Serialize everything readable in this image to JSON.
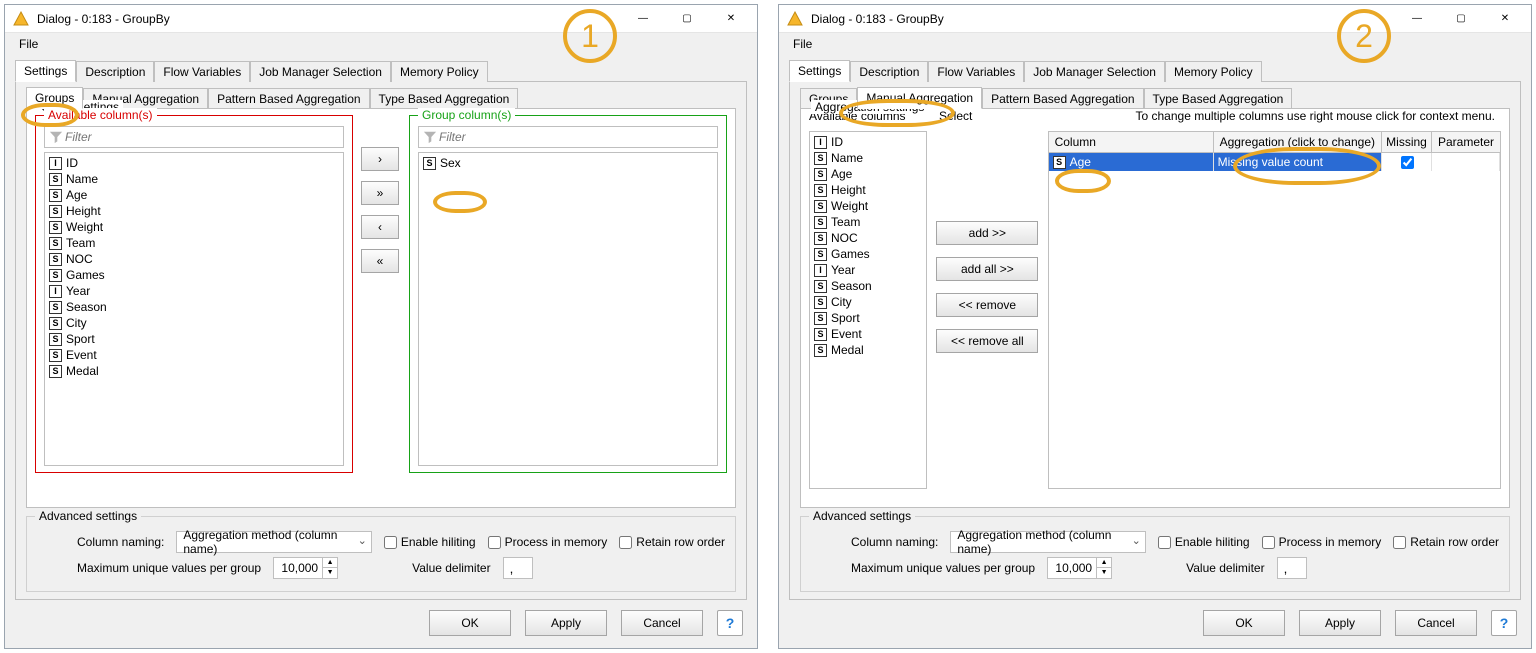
{
  "windowTitle": "Dialog - 0:183 - GroupBy",
  "menu": {
    "file": "File"
  },
  "tabs": {
    "outer": [
      "Settings",
      "Description",
      "Flow Variables",
      "Job Manager Selection",
      "Memory Policy"
    ],
    "inner": [
      "Groups",
      "Manual Aggregation",
      "Pattern Based Aggregation",
      "Type Based Aggregation"
    ]
  },
  "groupSettings": {
    "title": "Group settings",
    "availableTitle": "Available column(s)",
    "groupTitle": "Group column(s)",
    "filterPlaceholder": "Filter",
    "available": [
      {
        "type": "I",
        "name": "ID"
      },
      {
        "type": "S",
        "name": "Name"
      },
      {
        "type": "S",
        "name": "Age"
      },
      {
        "type": "S",
        "name": "Height"
      },
      {
        "type": "S",
        "name": "Weight"
      },
      {
        "type": "S",
        "name": "Team"
      },
      {
        "type": "S",
        "name": "NOC"
      },
      {
        "type": "S",
        "name": "Games"
      },
      {
        "type": "I",
        "name": "Year"
      },
      {
        "type": "S",
        "name": "Season"
      },
      {
        "type": "S",
        "name": "City"
      },
      {
        "type": "S",
        "name": "Sport"
      },
      {
        "type": "S",
        "name": "Event"
      },
      {
        "type": "S",
        "name": "Medal"
      }
    ],
    "group": [
      {
        "type": "S",
        "name": "Sex"
      }
    ],
    "transfer": {
      "addOne": "›",
      "addAll": "»",
      "removeOne": "‹",
      "removeAll": "«"
    }
  },
  "aggSettings": {
    "title": "Aggregation settings",
    "availableTitle": "Available columns",
    "selectTitle": "Select",
    "hint": "To change multiple columns use right mouse click for context menu.",
    "available": [
      {
        "type": "I",
        "name": "ID"
      },
      {
        "type": "S",
        "name": "Name"
      },
      {
        "type": "S",
        "name": "Age"
      },
      {
        "type": "S",
        "name": "Height"
      },
      {
        "type": "S",
        "name": "Weight"
      },
      {
        "type": "S",
        "name": "Team"
      },
      {
        "type": "S",
        "name": "NOC"
      },
      {
        "type": "S",
        "name": "Games"
      },
      {
        "type": "I",
        "name": "Year"
      },
      {
        "type": "S",
        "name": "Season"
      },
      {
        "type": "S",
        "name": "City"
      },
      {
        "type": "S",
        "name": "Sport"
      },
      {
        "type": "S",
        "name": "Event"
      },
      {
        "type": "S",
        "name": "Medal"
      }
    ],
    "buttons": {
      "add": "add >>",
      "addAll": "add all >>",
      "remove": "<< remove",
      "removeAll": "<< remove all"
    },
    "table": {
      "headers": {
        "column": "Column",
        "agg": "Aggregation (click to change)",
        "missing": "Missing",
        "param": "Parameter"
      },
      "rows": [
        {
          "type": "S",
          "column": "Age",
          "agg": "Missing value count",
          "missing": true,
          "param": ""
        }
      ]
    }
  },
  "advanced": {
    "title": "Advanced settings",
    "columnNamingLabel": "Column naming:",
    "columnNamingValue": "Aggregation method (column name)",
    "enableHiliting": "Enable hiliting",
    "processInMemory": "Process in memory",
    "retainRowOrder": "Retain row order",
    "maxUniqueLabel": "Maximum unique values per group",
    "maxUniqueValue": "10,000",
    "valueDelimiterLabel": "Value delimiter",
    "valueDelimiterValue": ","
  },
  "buttons": {
    "ok": "OK",
    "apply": "Apply",
    "cancel": "Cancel",
    "help": "?"
  },
  "annotation": {
    "badge1": "1",
    "badge2": "2"
  }
}
